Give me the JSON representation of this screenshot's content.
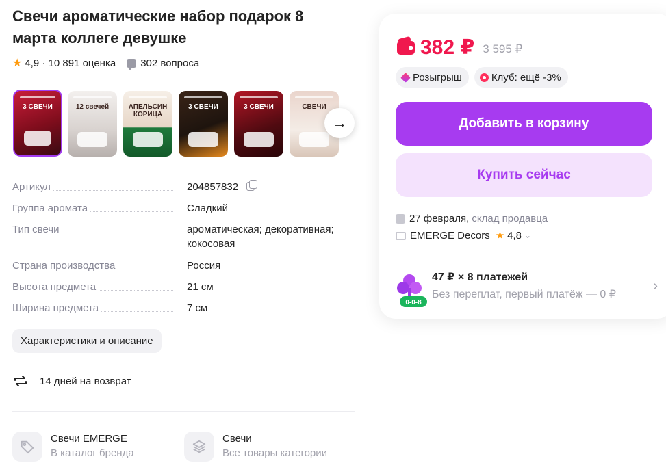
{
  "product": {
    "title": "Свечи ароматические набор подарок 8 марта коллеге девушке",
    "rating": "4,9 · 10 891 оценка",
    "questions": "302 вопроса"
  },
  "gallery": {
    "thumbs": [
      {
        "caption": "3 СВЕЧИ"
      },
      {
        "caption": "12 свечей"
      },
      {
        "caption": "АПЕЛЬСИН КОРИЦА"
      },
      {
        "caption": "3 СВЕЧИ"
      },
      {
        "caption": "3 СВЕЧИ"
      },
      {
        "caption": "СВЕЧИ"
      }
    ],
    "next_icon": "arrow-right-icon"
  },
  "specs": [
    {
      "key": "Артикул",
      "value": "204857832"
    },
    {
      "key": "Группа аромата",
      "value": "Сладкий"
    },
    {
      "key": "Тип свечи",
      "value": "ароматическая; декоративная; кокосовая"
    },
    {
      "key": "Страна производства",
      "value": "Россия"
    },
    {
      "key": "Высота предмета",
      "value": "21 см"
    },
    {
      "key": "Ширина предмета",
      "value": "7 см"
    }
  ],
  "characteristics_button": "Характеристики и описание",
  "return_policy": "14 дней на возврат",
  "brand_cards": [
    {
      "name": "Свечи EMERGE",
      "sub": "В каталог бренда"
    },
    {
      "name": "Свечи",
      "sub": "Все товары категории"
    }
  ],
  "buy_panel": {
    "price": "382 ₽",
    "old_price": "3 595 ₽",
    "chips": [
      "Розыгрыш",
      "Клуб: ещё -3%"
    ],
    "add_to_cart": "Добавить в корзину",
    "buy_now": "Купить сейчас",
    "delivery_date": "27 февраля,",
    "delivery_source": "склад продавца",
    "seller_name": "EMERGE Decors",
    "seller_rating": "4,8",
    "installment_title": "47 ₽ × 8 платежей",
    "installment_sub": "Без переплат, первый платёж — 0 ₽",
    "installment_badge": "0-0-8"
  },
  "colors": {
    "accent": "#a73bf0",
    "price": "#f0184e",
    "star": "#ff9a0c"
  }
}
